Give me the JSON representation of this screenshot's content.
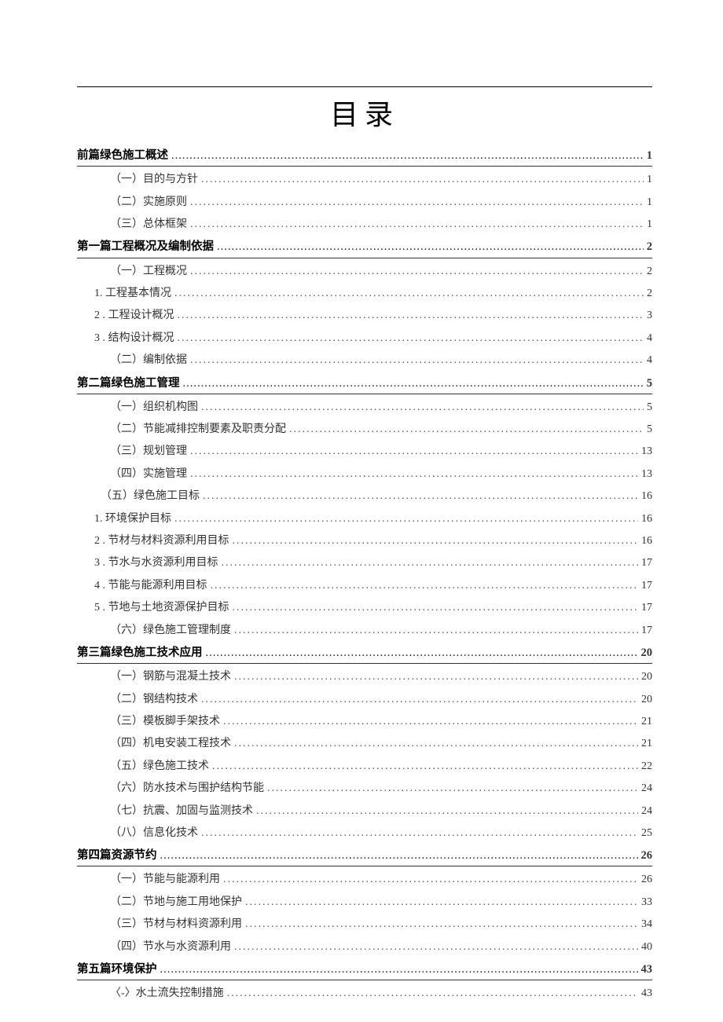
{
  "title": "目录",
  "entries": [
    {
      "level": "heading",
      "label": "前篇绿色施工概述",
      "page": "1"
    },
    {
      "level": "sub1",
      "label": "（一）目的与方针",
      "page": "1"
    },
    {
      "level": "sub1",
      "label": "（二）实施原则",
      "page": "1"
    },
    {
      "level": "sub1",
      "label": "（三）总体框架",
      "page": "1"
    },
    {
      "level": "heading",
      "label": "第一篇工程概况及编制依据",
      "page": "2"
    },
    {
      "level": "sub1",
      "label": "（一）工程概况",
      "page": "2"
    },
    {
      "level": "sub2",
      "label": "1. 工程基本情况",
      "page": "2"
    },
    {
      "level": "sub2",
      "label": "2  . 工程设计概况 ",
      "page": "3"
    },
    {
      "level": "sub2",
      "label": "3  . 结构设计概况 ",
      "page": "4"
    },
    {
      "level": "sub1",
      "label": "（二）编制依据",
      "page": "4"
    },
    {
      "level": "heading",
      "label": "第二篇绿色施工管理",
      "page": "5"
    },
    {
      "level": "sub1",
      "label": "（一）组织机构图",
      "page": "5"
    },
    {
      "level": "sub1",
      "label": "（二）节能减排控制要素及职责分配",
      "page": "5"
    },
    {
      "level": "sub1",
      "label": "（三）规划管理",
      "page": "13"
    },
    {
      "level": "sub1",
      "label": "（四）实施管理",
      "page": "13"
    },
    {
      "level": "sub1",
      "label": "（五）绿色施工目标",
      "page": "16",
      "altIndent": "30px"
    },
    {
      "level": "sub2",
      "label": "1. 环境保护目标",
      "page": "16"
    },
    {
      "level": "sub2",
      "label": "2  . 节材与材料资源利用目标 ",
      "page": "16"
    },
    {
      "level": "sub2",
      "label": "3  . 节水与水资源利用目标 ",
      "page": "17"
    },
    {
      "level": "sub2",
      "label": "4  . 节能与能源利用目标 ",
      "page": "17"
    },
    {
      "level": "sub2",
      "label": "5  . 节地与土地资源保护目标",
      "page": "17"
    },
    {
      "level": "sub1",
      "label": "（六）绿色施工管理制度",
      "page": "17"
    },
    {
      "level": "heading",
      "label": "第三篇绿色施工技术应用",
      "page": "20"
    },
    {
      "level": "sub1",
      "label": "（一）钢筋与混凝土技术",
      "page": "20"
    },
    {
      "level": "sub1",
      "label": "（二）钢结构技术",
      "page": "20"
    },
    {
      "level": "sub1",
      "label": "（三）模板脚手架技术 ",
      "page": "21"
    },
    {
      "level": "sub1",
      "label": "（四）机电安装工程技术",
      "page": "21"
    },
    {
      "level": "sub1",
      "label": "（五）绿色施工技术",
      "page": "22"
    },
    {
      "level": "sub1",
      "label": "（六）防水技术与围护结构节能",
      "page": "24"
    },
    {
      "level": "sub1",
      "label": "（七）抗震、加固与监测技术",
      "page": "24"
    },
    {
      "level": "sub1",
      "label": "（八）信息化技术",
      "page": "25"
    },
    {
      "level": "heading",
      "label": "第四篇资源节约",
      "page": "26"
    },
    {
      "level": "sub1",
      "label": "（一）节能与能源利用",
      "page": "26"
    },
    {
      "level": "sub1",
      "label": "（二）节地与施工用地保护",
      "page": "33"
    },
    {
      "level": "sub1",
      "label": "（三）节材与材料资源利用",
      "page": "34"
    },
    {
      "level": "sub1",
      "label": "（四）节水与水资源利用",
      "page": "40"
    },
    {
      "level": "heading",
      "label": "第五篇环境保护",
      "page": "43"
    },
    {
      "level": "sub1",
      "label": "〈-〉水土流失控制措施",
      "page": "43"
    }
  ]
}
